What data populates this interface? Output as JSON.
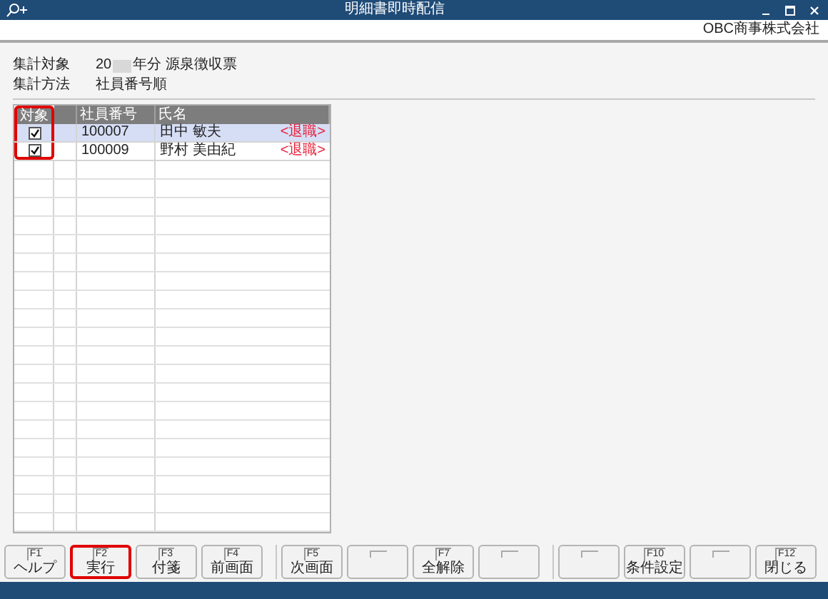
{
  "window": {
    "title": "明細書即時配信"
  },
  "company": "OBC商事株式会社",
  "info": [
    {
      "label": "集計対象",
      "prefix": "20",
      "redacted": true,
      "suffix": "年分 源泉徴収票"
    },
    {
      "label": "集計方法",
      "prefix": "社員番号順",
      "redacted": false
    }
  ],
  "table": {
    "columns": [
      {
        "label": "対象",
        "highlighted": true
      },
      {
        "highlighted": false
      },
      {
        "label": "社員番号",
        "highlighted": false
      },
      {
        "label": "氏名",
        "highlighted": false
      }
    ],
    "rows": [
      {
        "checked": true,
        "selected": true,
        "id": "100007",
        "name": "田中 敏夫",
        "status": "<退職>"
      },
      {
        "checked": true,
        "selected": false,
        "id": "100009",
        "name": "野村 美由紀",
        "status": "<退職>"
      }
    ]
  },
  "function_keys": [
    {
      "key": "F1",
      "label": "ヘルプ",
      "highlighted": false
    },
    {
      "key": "F2",
      "label": "実行",
      "highlighted": true
    },
    {
      "key": "F3",
      "label": "付箋",
      "highlighted": false
    },
    {
      "key": "F4",
      "label": "前画面",
      "highlighted": false
    },
    {
      "key": "F5",
      "label": "次画面",
      "highlighted": false
    },
    {
      "highlighted": false
    },
    {
      "key": "F7",
      "label": "全解除",
      "highlighted": false
    },
    {
      "highlighted": false
    },
    {
      "highlighted": false
    },
    {
      "key": "F10",
      "label": "条件設定",
      "highlighted": false
    },
    {
      "highlighted": false
    },
    {
      "key": "F12",
      "label": "閉じる",
      "highlighted": false
    }
  ]
}
